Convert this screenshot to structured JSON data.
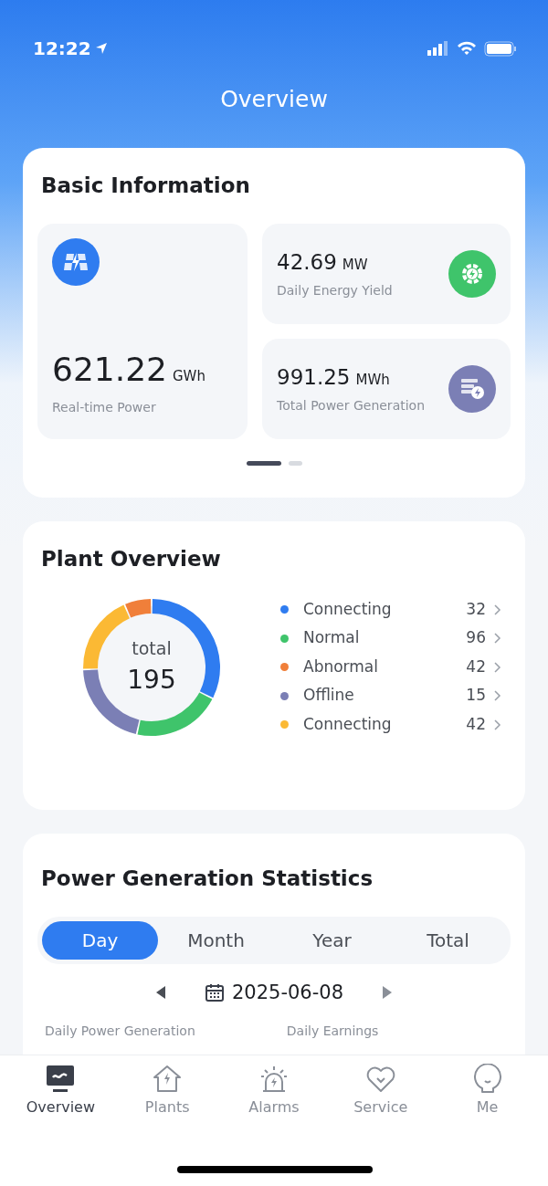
{
  "status_bar": {
    "time": "12:22"
  },
  "header": {
    "title": "Overview"
  },
  "basic_information": {
    "title": "Basic Information",
    "main_metric": {
      "value": "621.22",
      "unit": "GWh",
      "label": "Real-time Power"
    },
    "metrics": [
      {
        "value": "42.69",
        "unit": "MW",
        "label": "Daily Energy Yield",
        "color": "#3fc46b"
      },
      {
        "value": "991.25",
        "unit": "MWh",
        "label": "Total Power Generation",
        "color": "#7b7fb5"
      }
    ],
    "pager": [
      {
        "selected": true
      },
      {
        "selected": false
      }
    ]
  },
  "plant_overview": {
    "title": "Plant Overview",
    "center_label": "total",
    "center_value": "195",
    "chart_data": {
      "type": "donut",
      "values": [
        32.5,
        21,
        21,
        19,
        6.5
      ],
      "colors": [
        "#2f7cf0",
        "#3fc46b",
        "#7b7fb5",
        "#fbb934",
        "#f07f3a"
      ]
    },
    "legend": [
      {
        "label": "Connecting",
        "count": "32",
        "color": "#2f7cf0"
      },
      {
        "label": "Normal",
        "count": "96",
        "color": "#3fc46b"
      },
      {
        "label": "Abnormal",
        "count": "42",
        "color": "#f07f3a"
      },
      {
        "label": "Offline",
        "count": "15",
        "color": "#7b7fb5"
      },
      {
        "label": "Connecting",
        "count": "42",
        "color": "#fbb934"
      }
    ]
  },
  "power_statistics": {
    "title": "Power Generation Statistics",
    "periods": [
      {
        "label": "Day",
        "selected": true
      },
      {
        "label": "Month",
        "selected": false
      },
      {
        "label": "Year",
        "selected": false
      },
      {
        "label": "Total",
        "selected": false
      }
    ],
    "date": "2025-06-08",
    "summary_labels": [
      "Daily Power Generation",
      "Daily Earnings"
    ]
  },
  "tab_bar": [
    {
      "label": "Overview",
      "kind": "overview",
      "selected": true
    },
    {
      "label": "Plants",
      "kind": "plants",
      "selected": false
    },
    {
      "label": "Alarms",
      "kind": "alarms",
      "selected": false
    },
    {
      "label": "Service",
      "kind": "service",
      "selected": false
    },
    {
      "label": "Me",
      "kind": "me",
      "selected": false
    }
  ]
}
